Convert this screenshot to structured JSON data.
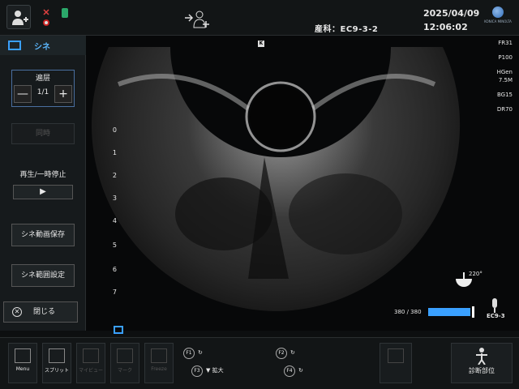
{
  "header": {
    "exam_label": "産科：EC9-3-2",
    "date": "2025/04/09",
    "time": "12:06:02",
    "logo_text": "KONICA MINOLTA"
  },
  "cine_panel": {
    "title": "シネ",
    "layer_label": "遍层",
    "layer_value": "1/1",
    "minus": "—",
    "plus": "+",
    "compare": "同時",
    "play_label": "再生/一時停止",
    "play_glyph": "▶",
    "save": "シネ動画保存",
    "range": "シネ範囲設定",
    "close": "閉じる"
  },
  "image": {
    "k_marker": "K",
    "depth_ticks": [
      "0",
      "1",
      "2",
      "3",
      "4",
      "5",
      "6",
      "7"
    ],
    "params": [
      "FR31",
      "P100",
      "HGen",
      "7.5M",
      "BG15",
      "DR70"
    ],
    "angle": "220°",
    "frame_counter": "380 / 380",
    "frame_fraction": 1.0,
    "probe": "EC9-3"
  },
  "bottombar": {
    "menu": "Menu",
    "split": "スプリット",
    "b3": "マイビュー",
    "b4": "マーク",
    "b5": "Freeze",
    "f1": "F1",
    "f2": "F2",
    "f3": "F3",
    "f4": "F4",
    "zoom": "▼ 拡大",
    "diag": "診断部位"
  },
  "colors": {
    "accent": "#3aa0ff",
    "background": "#0d0f10"
  }
}
